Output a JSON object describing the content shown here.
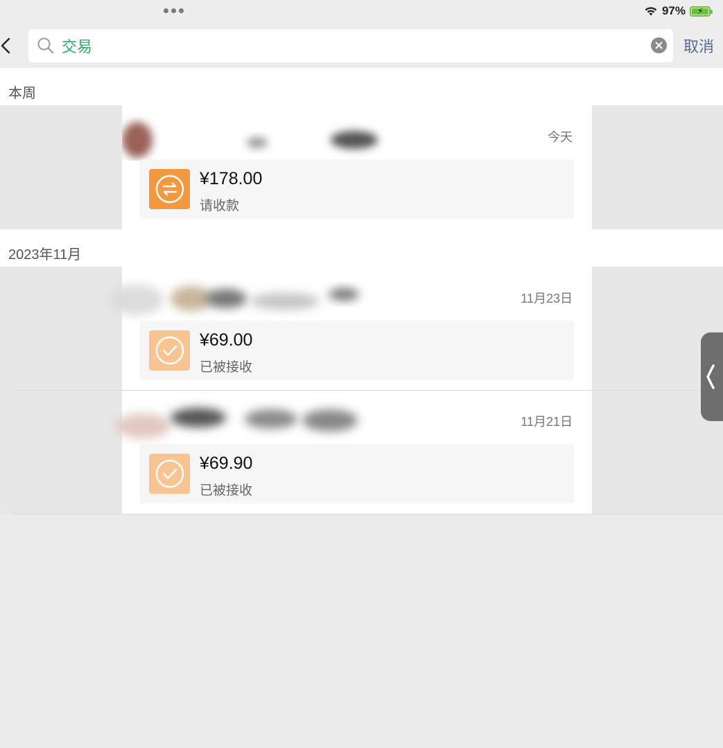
{
  "status_bar": {
    "battery_text": "97%",
    "battery_color": "#6fbf45"
  },
  "search": {
    "query": "交易",
    "cancel_label": "取消",
    "query_color": "#2aae67"
  },
  "sections": [
    {
      "title": "本周",
      "records": [
        {
          "date": "今天",
          "amount": "¥178.00",
          "status": "请收款",
          "icon": "transfer-arrows-icon",
          "icon_color": "#f3983e"
        }
      ]
    },
    {
      "title": "2023年11月",
      "records": [
        {
          "date": "11月23日",
          "amount": "¥69.00",
          "status": "已被接收",
          "icon": "check-icon",
          "icon_color": "#f8c491"
        },
        {
          "date": "11月21日",
          "amount": "¥69.90",
          "status": "已被接收",
          "icon": "check-icon",
          "icon_color": "#f8c491"
        }
      ]
    }
  ],
  "icons": {
    "back": "chevron-left-icon",
    "search": "search-icon",
    "clear": "clear-icon",
    "side_handle": "chevron-left-icon"
  }
}
